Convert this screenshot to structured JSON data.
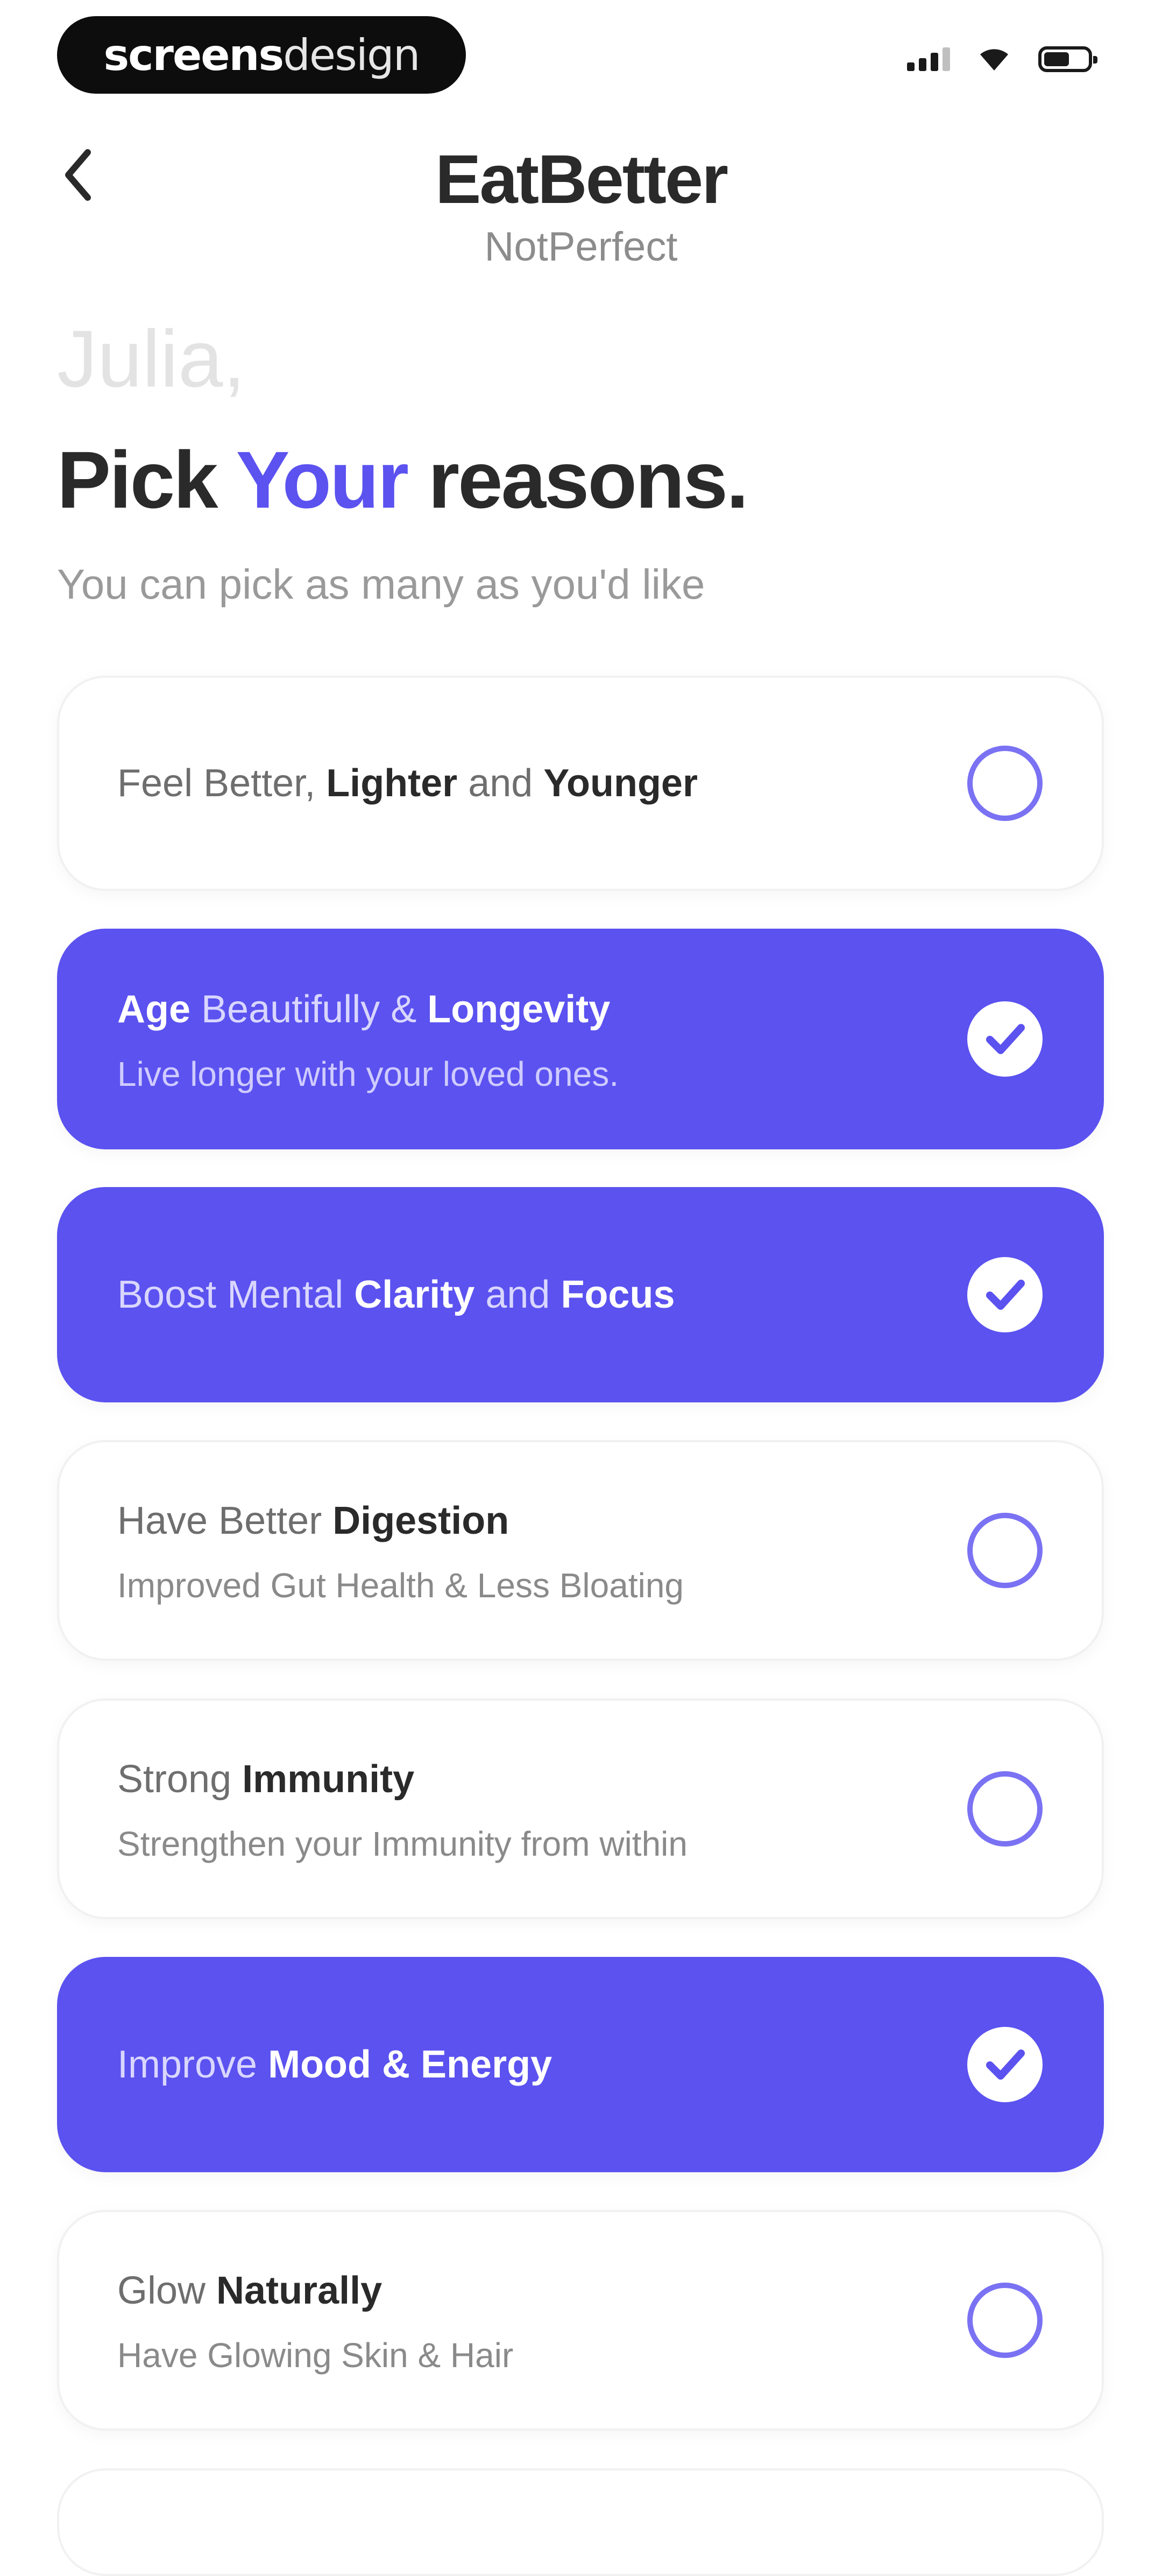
{
  "status_bar": {
    "brand_part1": "screens",
    "brand_part2": "design"
  },
  "header": {
    "title": "EatBetter",
    "subtitle": "NotPerfect"
  },
  "intro": {
    "greeting": "Julia,",
    "heading_pre": "Pick ",
    "heading_accent": "Your",
    "heading_post": " reasons.",
    "helper": "You can pick as many as you'd like"
  },
  "colors": {
    "accent": "#5b52f0",
    "text_dark": "#2a2a2a",
    "text_muted": "#8a8a8a"
  },
  "reasons": [
    {
      "title_parts": [
        {
          "text": "Feel Better, ",
          "bold": false
        },
        {
          "text": "Lighter",
          "bold": true
        },
        {
          "text": " and ",
          "bold": false
        },
        {
          "text": "Younger",
          "bold": true
        }
      ],
      "subtitle": "",
      "selected": false
    },
    {
      "title_parts": [
        {
          "text": "Age",
          "bold": true
        },
        {
          "text": " Beautifully & ",
          "bold": false
        },
        {
          "text": "Longevity",
          "bold": true
        }
      ],
      "subtitle": "Live longer with your loved ones.",
      "selected": true
    },
    {
      "title_parts": [
        {
          "text": "Boost Mental ",
          "bold": false
        },
        {
          "text": "Clarity",
          "bold": true
        },
        {
          "text": " and ",
          "bold": false
        },
        {
          "text": "Focus",
          "bold": true
        }
      ],
      "subtitle": "",
      "selected": true
    },
    {
      "title_parts": [
        {
          "text": "Have Better ",
          "bold": false
        },
        {
          "text": "Digestion",
          "bold": true
        }
      ],
      "subtitle": "Improved Gut Health & Less Bloating",
      "selected": false
    },
    {
      "title_parts": [
        {
          "text": "Strong ",
          "bold": false
        },
        {
          "text": "Immunity",
          "bold": true
        }
      ],
      "subtitle": "Strengthen your Immunity from within",
      "selected": false
    },
    {
      "title_parts": [
        {
          "text": "Improve ",
          "bold": false
        },
        {
          "text": "Mood & Energy",
          "bold": true
        }
      ],
      "subtitle": "",
      "selected": true
    },
    {
      "title_parts": [
        {
          "text": "Glow ",
          "bold": false
        },
        {
          "text": "Naturally",
          "bold": true
        }
      ],
      "subtitle": "Have Glowing Skin & Hair",
      "selected": false
    }
  ]
}
